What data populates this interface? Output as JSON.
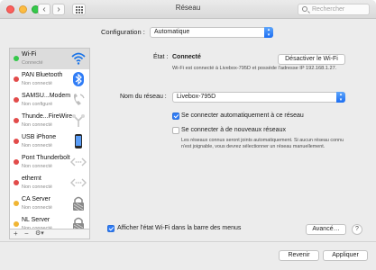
{
  "window": {
    "title": "Réseau"
  },
  "toolbar": {
    "back": "‹",
    "forward": "›",
    "search_placeholder": "Rechercher"
  },
  "configuration": {
    "label": "Configuration :",
    "value": "Automatique"
  },
  "sidebar": {
    "items": [
      {
        "name": "Wi-Fi",
        "status": "Connecté",
        "dot": "#35c84a",
        "icon": "wifi-icon"
      },
      {
        "name": "PAN Bluetooth",
        "status": "Non connecté",
        "dot": "#e24b4a",
        "icon": "bluetooth-icon"
      },
      {
        "name": "SAMSU...Modem",
        "status": "Non configuré",
        "dot": "#e24b4a",
        "icon": "phone-modem-icon"
      },
      {
        "name": "Thunde...FireWire",
        "status": "Non connecté",
        "dot": "#e24b4a",
        "icon": "firewire-icon"
      },
      {
        "name": "USB iPhone",
        "status": "Non connecté",
        "dot": "#e24b4a",
        "icon": "iphone-icon"
      },
      {
        "name": "Pont Thunderbolt",
        "status": "Non connecté",
        "dot": "#e24b4a",
        "icon": "ethernet-bridge-icon"
      },
      {
        "name": "ethernt",
        "status": "Non connecté",
        "dot": "#e24b4a",
        "icon": "ethernet-icon"
      },
      {
        "name": "CA Server",
        "status": "Non connecté",
        "dot": "#f0b534",
        "icon": "vpn-lock-icon"
      },
      {
        "name": "NL Server",
        "status": "Non connecté",
        "dot": "#f0b534",
        "icon": "vpn-lock-icon"
      }
    ],
    "add": "+",
    "remove": "−",
    "actions": "⚙︎▾"
  },
  "detail": {
    "status_label": "État :",
    "status_value": "Connecté",
    "disable_button": "Désactiver le Wi-Fi",
    "status_desc": "Wi-Fi est connecté à Livebox-795D et possède l'adresse IP 192.168.1.27.",
    "network_label": "Nom du réseau :",
    "network_value": "Livebox-795D",
    "auto_join": {
      "label": "Se connecter automatiquement à ce réseau",
      "checked": true
    },
    "ask_new": {
      "label": "Se connecter à de nouveaux réseaux",
      "checked": false
    },
    "ask_desc": "Les réseaux connus seront joints automatiquement. Si aucun réseau connu n'est joignable, vous devrez sélectionner un réseau manuellement.",
    "show_status": {
      "label": "Afficher l'état Wi-Fi dans la barre des menus",
      "checked": true
    },
    "advanced_button": "Avancé…",
    "help": "?"
  },
  "footer": {
    "revert": "Revenir",
    "apply": "Appliquer"
  }
}
